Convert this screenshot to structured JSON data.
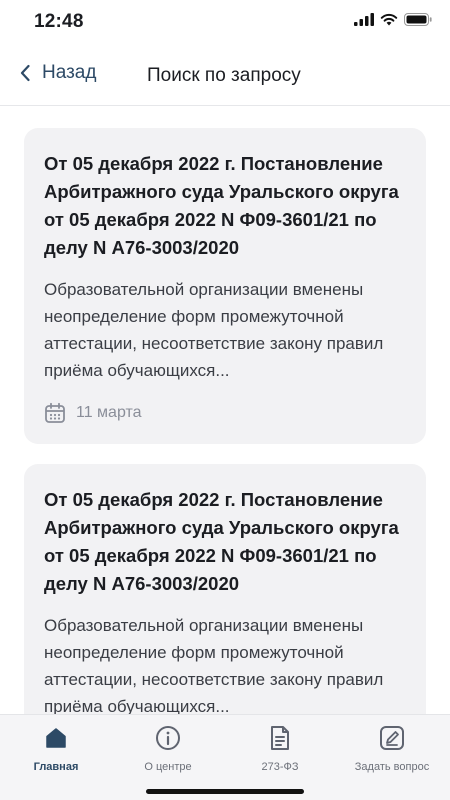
{
  "status": {
    "time": "12:48"
  },
  "nav": {
    "back_label": "Назад",
    "title": "Поиск по запросу"
  },
  "results": [
    {
      "title": "От 05 декабря 2022 г. Постановление Арбитражного суда Уральского округа от 05 декабря 2022 N Ф09-3601/21 по делу N А76-3003/2020",
      "description": "Образовательной организации вменены неопределение форм промежуточной аттестации, несоответствие закону правил приёма обучающихся...",
      "date": "11 марта"
    },
    {
      "title": "От 05 декабря 2022 г. Постановление Арбитражного суда Уральского округа от 05 декабря 2022 N Ф09-3601/21 по делу N А76-3003/2020",
      "description": "Образовательной организации вменены неопределение форм промежуточной аттестации, несоответствие закону правил приёма обучающихся..."
    }
  ],
  "tabs": [
    {
      "label": "Главная",
      "icon": "home-icon",
      "active": true
    },
    {
      "label": "О центре",
      "icon": "info-icon",
      "active": false
    },
    {
      "label": "273-ФЗ",
      "icon": "document-icon",
      "active": false
    },
    {
      "label": "Задать вопрос",
      "icon": "edit-icon",
      "active": false
    }
  ],
  "colors": {
    "accent": "#2d4a66",
    "card_bg": "#f2f2f4",
    "muted": "#8a8e99"
  }
}
